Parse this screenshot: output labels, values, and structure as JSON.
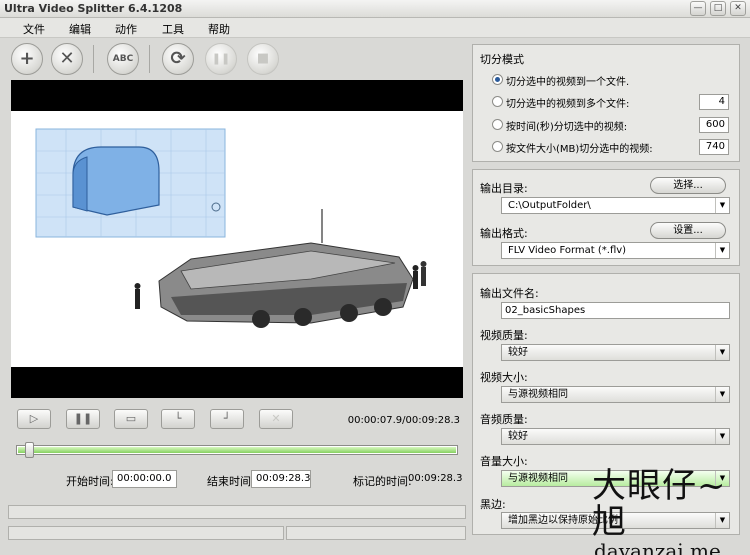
{
  "window": {
    "title": "Ultra Video Splitter 6.4.1208",
    "buttons": {
      "minimize": "—",
      "maximize": "□",
      "close": "✕"
    }
  },
  "menu": [
    "文件",
    "编辑",
    "动作",
    "工具",
    "帮助"
  ],
  "toolbar": {
    "add_icon": "+",
    "remove_icon": "✕",
    "rename_label": "ABC",
    "refresh_icon": "⟳",
    "pause_icon": "❚❚",
    "stop_icon": "■"
  },
  "controls": {
    "timecode": "00:00:07.9/00:09:28.3",
    "start_label": "开始时间:",
    "start_value": "00:00:00.0",
    "end_label": "结束时间:",
    "end_value": "00:09:28.3",
    "marked_label": "标记的时间:",
    "marked_value": "00:09:28.3",
    "progress_fraction": 0.014
  },
  "split_mode": {
    "title": "切分模式",
    "options": [
      {
        "label": "切分选中的视频到一个文件.",
        "selected": true
      },
      {
        "label": "切分选中的视频到多个文件:",
        "value": "4"
      },
      {
        "label": "按时间(秒)分切选中的视频:",
        "value": "600"
      },
      {
        "label": "按文件大小(MB)切分选中的视频:",
        "value": "740"
      }
    ]
  },
  "output": {
    "dir_label": "输出目录:",
    "dir_button": "选择...",
    "dir_value": "C:\\OutputFolder\\",
    "format_label": "输出格式:",
    "format_button": "设置...",
    "format_value": "FLV Video Format (*.flv)"
  },
  "settings": {
    "filename_label": "输出文件名:",
    "filename_value": "02_basicShapes",
    "video_quality_label": "视频质量:",
    "video_quality_value": "较好",
    "video_size_label": "视频大小:",
    "video_size_value": "与源视频相同",
    "audio_quality_label": "音频质量:",
    "audio_quality_value": "较好",
    "volume_label": "音量大小:",
    "volume_value": "与源视频相同",
    "border_label": "黑边:",
    "border_value": "增加黑边以保持原始比例"
  },
  "watermark": {
    "cn": "大眼仔~旭",
    "url": "dayanzai.me"
  }
}
